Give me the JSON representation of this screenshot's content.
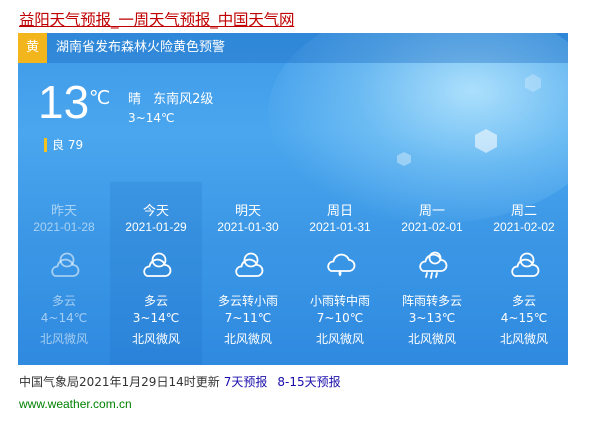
{
  "page": {
    "title_part1": "益阳",
    "title_part2": "天气预报",
    "title_part3": "_一周",
    "title_part4": "天气预报",
    "title_part5": "_中国",
    "title_part6": "天气",
    "title_part7": "网"
  },
  "alert": {
    "badge": "黄",
    "text": "湖南省发布森林火险黄色预警",
    "badge_color": "#f2b51c"
  },
  "current": {
    "temp": "13",
    "unit": "℃",
    "condition": "晴 东南风2级",
    "range": "3~14℃",
    "aqi_label": "良 79"
  },
  "forecast": [
    {
      "name": "昨天",
      "date": "2021-01-28",
      "desc": "多云",
      "range": "4~14℃",
      "wind": "北风微风",
      "icon": "cloudy-icon",
      "past": true
    },
    {
      "name": "今天",
      "date": "2021-01-29",
      "desc": "多云",
      "range": "3~14℃",
      "wind": "北风微风",
      "icon": "cloudy-icon",
      "today": true
    },
    {
      "name": "明天",
      "date": "2021-01-30",
      "desc": "多云转小雨",
      "range": "7~11℃",
      "wind": "北风微风",
      "icon": "cloudy-icon"
    },
    {
      "name": "周日",
      "date": "2021-01-31",
      "desc": "小雨转中雨",
      "range": "7~10℃",
      "wind": "北风微风",
      "icon": "rain-icon"
    },
    {
      "name": "周一",
      "date": "2021-02-01",
      "desc": "阵雨转多云",
      "range": "3~13℃",
      "wind": "北风微风",
      "icon": "shower-icon"
    },
    {
      "name": "周二",
      "date": "2021-02-02",
      "desc": "多云",
      "range": "4~15℃",
      "wind": "北风微风",
      "icon": "cloudy-icon"
    }
  ],
  "footer": {
    "source": "中国气象局2021年1月29日14时更新",
    "link1": "7天预报",
    "link2": "8-15天预报",
    "site": "www.weather.com.cn"
  }
}
